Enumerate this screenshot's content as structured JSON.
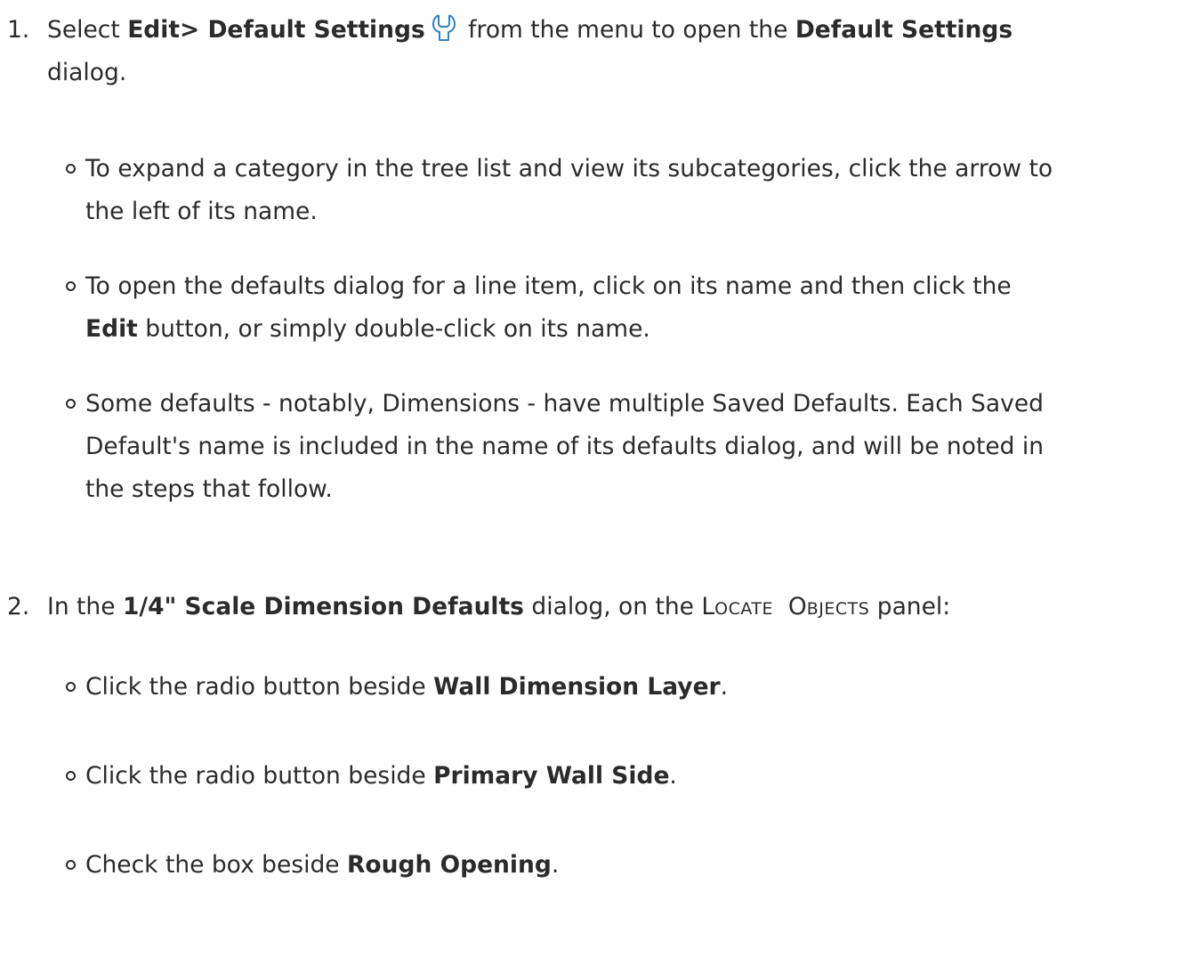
{
  "steps": [
    {
      "number": "1.",
      "line1": {
        "pre": "Select ",
        "menu_path": "Edit> Default Settings",
        "icon": "wrench-icon",
        "mid": " from the menu to open the ",
        "dialog_name": "Default Settings"
      },
      "line2": "dialog.",
      "bullets": [
        {
          "line1": "To expand a category in the tree list and view its subcategories, click the arrow to",
          "line2": "the left of its name."
        },
        {
          "line1": "To open the defaults dialog for a line item, click on its name and then click the",
          "line2_bold": "Edit",
          "line2_rest": " button, or simply double-click on its name."
        },
        {
          "line1": "Some defaults - notably, Dimensions - have multiple Saved Defaults. Each Saved",
          "line2": "Default's name is included in the name of its defaults dialog, and will be noted in",
          "line3": "the steps that follow."
        }
      ]
    },
    {
      "number": "2.",
      "line1": {
        "pre": "In the ",
        "dialog_name": "1/4\" Scale Dimension Defaults",
        "mid": " dialog, on the ",
        "panel_big1": "L",
        "panel_small1": "OCATE",
        "panel_big2": "O",
        "panel_small2": "BJECTS",
        "post": " panel:"
      },
      "bullets": [
        {
          "pre": "Click the radio button beside ",
          "bold": "Wall Dimension Layer",
          "post": "."
        },
        {
          "pre": "Click the radio button beside ",
          "bold": "Primary Wall Side",
          "post": "."
        },
        {
          "pre": "Check the box beside ",
          "bold": "Rough Opening",
          "post": "."
        }
      ]
    }
  ],
  "colors": {
    "text": "#2b2b2b",
    "icon": "#2f80c8"
  }
}
